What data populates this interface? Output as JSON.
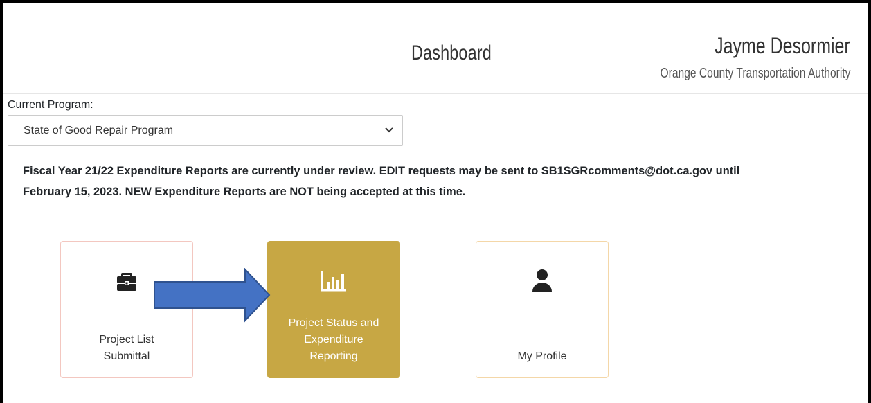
{
  "header": {
    "title": "Dashboard",
    "user_name": "Jayme Desormier",
    "user_org": "Orange County Transportation Authority"
  },
  "program": {
    "label": "Current Program:",
    "selected": "State of Good Repair Program"
  },
  "notice": {
    "line1": "Fiscal Year 21/22 Expenditure Reports are currently under review. EDIT requests may be sent to SB1SGRcomments@dot.ca.gov until",
    "line2": "February 15, 2023. NEW Expenditure Reports are NOT being accepted at this time."
  },
  "tiles": [
    {
      "label_line1": "Project List",
      "label_line2": "Submittal",
      "icon": "briefcase-icon"
    },
    {
      "label_line1": "Project Status and",
      "label_line2": "Expenditure",
      "label_line3": "Reporting",
      "icon": "bar-chart-icon"
    },
    {
      "label_line1": "My Profile",
      "icon": "user-icon"
    }
  ],
  "colors": {
    "active_tile": "#c7a744",
    "arrow": "#4472c4",
    "arrow_stroke": "#2f528f"
  }
}
